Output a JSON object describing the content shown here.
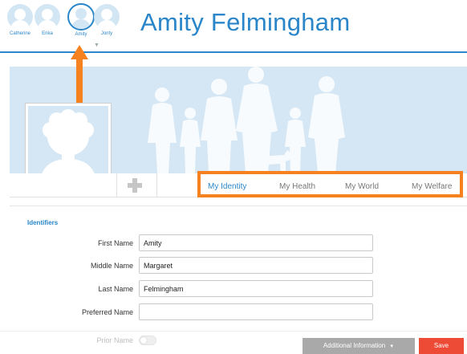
{
  "header": {
    "title": "Amity Felmingham",
    "people": [
      {
        "name": "Catherine",
        "active": false
      },
      {
        "name": "Erika",
        "active": false
      },
      {
        "name": "Amity",
        "active": true
      },
      {
        "name": "Jonty",
        "active": false
      }
    ],
    "more_icon": "chevron-down-icon"
  },
  "tabs": [
    {
      "label": "My Identity",
      "active": true
    },
    {
      "label": "My Health",
      "active": false
    },
    {
      "label": "My World",
      "active": false
    },
    {
      "label": "My Welfare",
      "active": false
    }
  ],
  "add_icon": "plus-icon",
  "form": {
    "section_title": "Identifiers",
    "fields": [
      {
        "label": "First Name",
        "value": "Amity"
      },
      {
        "label": "Middle Name",
        "value": "Margaret"
      },
      {
        "label": "Last Name",
        "value": "Felmingham"
      },
      {
        "label": "Preferred Name",
        "value": ""
      }
    ],
    "prior_name_label": "Prior Name",
    "prior_name_enabled": false
  },
  "footer": {
    "additional_label": "Additional Information",
    "save_label": "Save"
  },
  "colors": {
    "accent": "#2a86c8",
    "highlight": "#f5821f",
    "save": "#ee4b36",
    "banner": "#d5e7f4"
  }
}
